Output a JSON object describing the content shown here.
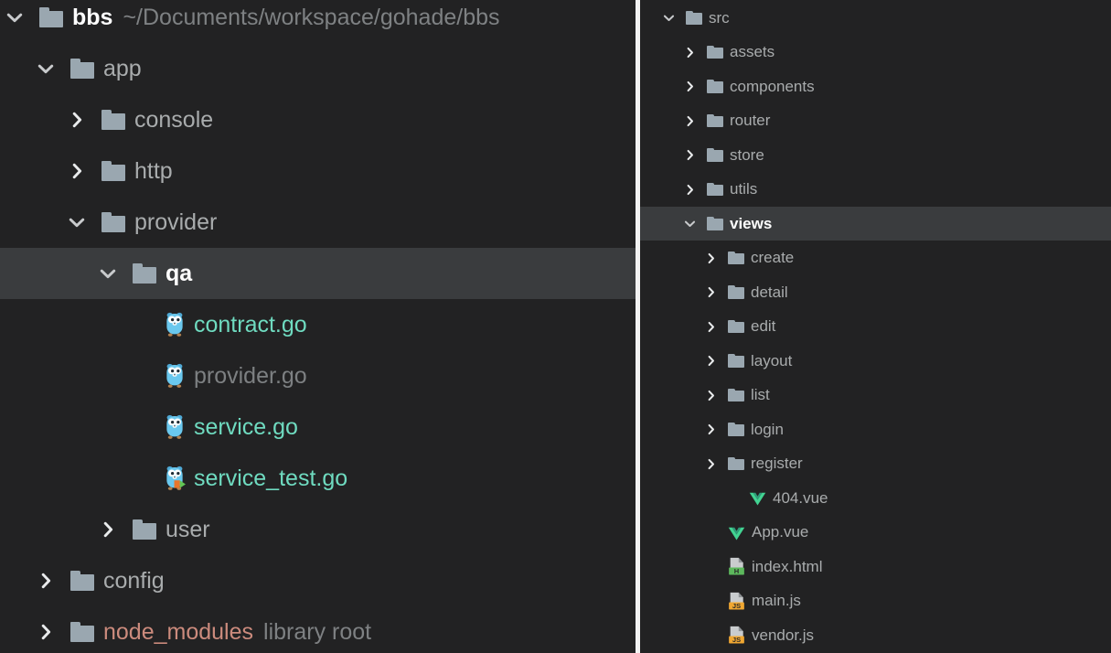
{
  "theme": {
    "background": "#222223",
    "selected_row_background": "#3a3c3e",
    "divider_color": "#f2f2f2",
    "text_default": "#a9acad",
    "text_selected": "#ffffff",
    "text_muted": "#7d8082",
    "go_file_color": "#6fdbc0",
    "library_root_color": "#cc8b7d",
    "folder_icon_color": "#9aa7b0",
    "vue_icon_color": "#42d392",
    "js_badge_color": "#f0a732",
    "html_badge_color": "#5cb85c",
    "gopher_body_color": "#6ad0f0"
  },
  "left_panel": {
    "name": "project-tree-left",
    "rows": [
      {
        "label": "bbs",
        "suffix": "~/Documents/workspace/gohade/bbs",
        "icon": "folder-icon",
        "twisty": "chevron-down-icon",
        "indent": 0,
        "style": "bold",
        "selected": false
      },
      {
        "label": "app",
        "suffix": "",
        "icon": "folder-icon",
        "twisty": "chevron-down-icon",
        "indent": 1,
        "style": "default",
        "selected": false
      },
      {
        "label": "console",
        "suffix": "",
        "icon": "folder-icon",
        "twisty": "chevron-right-icon",
        "indent": 2,
        "style": "default",
        "selected": false
      },
      {
        "label": "http",
        "suffix": "",
        "icon": "folder-icon",
        "twisty": "chevron-right-icon",
        "indent": 2,
        "style": "default",
        "selected": false
      },
      {
        "label": "provider",
        "suffix": "",
        "icon": "folder-icon",
        "twisty": "chevron-down-icon",
        "indent": 2,
        "style": "default",
        "selected": false
      },
      {
        "label": "qa",
        "suffix": "",
        "icon": "folder-icon",
        "twisty": "chevron-down-icon",
        "indent": 3,
        "style": "bold",
        "selected": true
      },
      {
        "label": "contract.go",
        "suffix": "",
        "icon": "go-gopher-icon",
        "twisty": "none",
        "indent": 4,
        "style": "go-active",
        "selected": false
      },
      {
        "label": "provider.go",
        "suffix": "",
        "icon": "go-gopher-icon",
        "twisty": "none",
        "indent": 4,
        "style": "go-dim",
        "selected": false
      },
      {
        "label": "service.go",
        "suffix": "",
        "icon": "go-gopher-icon",
        "twisty": "none",
        "indent": 4,
        "style": "go-active",
        "selected": false
      },
      {
        "label": "service_test.go",
        "suffix": "",
        "icon": "go-gopher-test-icon",
        "twisty": "none",
        "indent": 4,
        "style": "go-active",
        "selected": false
      },
      {
        "label": "user",
        "suffix": "",
        "icon": "folder-icon",
        "twisty": "chevron-right-icon",
        "indent": 3,
        "style": "default",
        "selected": false
      },
      {
        "label": "config",
        "suffix": "",
        "icon": "folder-icon",
        "twisty": "chevron-right-icon",
        "indent": 1,
        "style": "default",
        "selected": false
      },
      {
        "label": "node_modules",
        "suffix": "library root",
        "icon": "folder-icon",
        "twisty": "chevron-right-icon",
        "indent": 1,
        "style": "library",
        "selected": false
      }
    ]
  },
  "right_panel": {
    "name": "project-tree-right",
    "rows": [
      {
        "label": "src",
        "suffix": "",
        "icon": "folder-icon",
        "twisty": "chevron-down-icon",
        "indent": 0,
        "style": "default",
        "selected": false
      },
      {
        "label": "assets",
        "suffix": "",
        "icon": "folder-icon",
        "twisty": "chevron-right-icon",
        "indent": 1,
        "style": "default",
        "selected": false
      },
      {
        "label": "components",
        "suffix": "",
        "icon": "folder-icon",
        "twisty": "chevron-right-icon",
        "indent": 1,
        "style": "default",
        "selected": false
      },
      {
        "label": "router",
        "suffix": "",
        "icon": "folder-icon",
        "twisty": "chevron-right-icon",
        "indent": 1,
        "style": "default",
        "selected": false
      },
      {
        "label": "store",
        "suffix": "",
        "icon": "folder-icon",
        "twisty": "chevron-right-icon",
        "indent": 1,
        "style": "default",
        "selected": false
      },
      {
        "label": "utils",
        "suffix": "",
        "icon": "folder-icon",
        "twisty": "chevron-right-icon",
        "indent": 1,
        "style": "default",
        "selected": false
      },
      {
        "label": "views",
        "suffix": "",
        "icon": "folder-icon",
        "twisty": "chevron-down-icon",
        "indent": 1,
        "style": "bold",
        "selected": true
      },
      {
        "label": "create",
        "suffix": "",
        "icon": "folder-icon",
        "twisty": "chevron-right-icon",
        "indent": 2,
        "style": "default",
        "selected": false
      },
      {
        "label": "detail",
        "suffix": "",
        "icon": "folder-icon",
        "twisty": "chevron-right-icon",
        "indent": 2,
        "style": "default",
        "selected": false
      },
      {
        "label": "edit",
        "suffix": "",
        "icon": "folder-icon",
        "twisty": "chevron-right-icon",
        "indent": 2,
        "style": "default",
        "selected": false
      },
      {
        "label": "layout",
        "suffix": "",
        "icon": "folder-icon",
        "twisty": "chevron-right-icon",
        "indent": 2,
        "style": "default",
        "selected": false
      },
      {
        "label": "list",
        "suffix": "",
        "icon": "folder-icon",
        "twisty": "chevron-right-icon",
        "indent": 2,
        "style": "default",
        "selected": false
      },
      {
        "label": "login",
        "suffix": "",
        "icon": "folder-icon",
        "twisty": "chevron-right-icon",
        "indent": 2,
        "style": "default",
        "selected": false
      },
      {
        "label": "register",
        "suffix": "",
        "icon": "folder-icon",
        "twisty": "chevron-right-icon",
        "indent": 2,
        "style": "default",
        "selected": false
      },
      {
        "label": "404.vue",
        "suffix": "",
        "icon": "vue-file-icon",
        "twisty": "none",
        "indent": 3,
        "style": "default",
        "selected": false
      },
      {
        "label": "App.vue",
        "suffix": "",
        "icon": "vue-file-icon",
        "twisty": "none",
        "indent": 2,
        "style": "default",
        "selected": false
      },
      {
        "label": "index.html",
        "suffix": "",
        "icon": "html-file-icon",
        "twisty": "none",
        "indent": 2,
        "style": "default",
        "selected": false
      },
      {
        "label": "main.js",
        "suffix": "",
        "icon": "js-file-icon",
        "twisty": "none",
        "indent": 2,
        "style": "default",
        "selected": false
      },
      {
        "label": "vendor.js",
        "suffix": "",
        "icon": "js-file-icon",
        "twisty": "none",
        "indent": 2,
        "style": "default",
        "selected": false
      }
    ]
  }
}
